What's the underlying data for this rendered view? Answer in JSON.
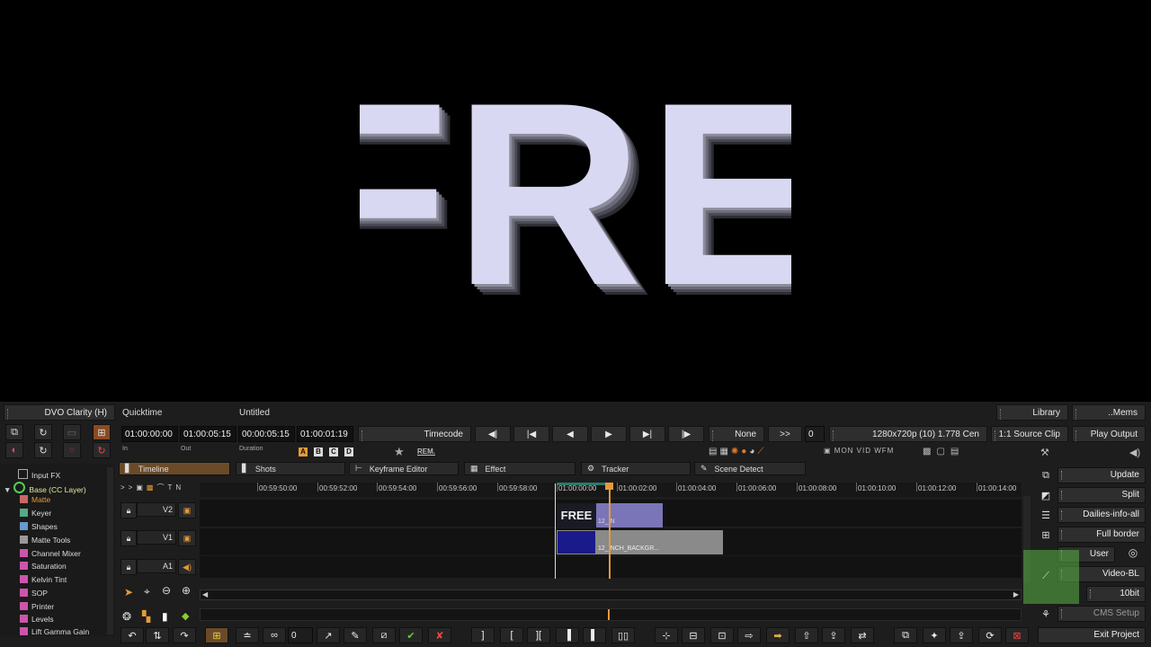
{
  "viewer": {
    "frame_text": "FREE"
  },
  "top": {
    "clarity_button": "DVO Clarity (H)",
    "format_label": "Quicktime",
    "title_label": "Untitled",
    "timecodes": [
      "01:00:00:00",
      "01:00:05:15",
      "00:00:05:15",
      "01:00:01:19"
    ],
    "timecode_captions": [
      "In",
      "Out",
      "Duration"
    ],
    "timecode_mode": "Timecode",
    "none_label": "None",
    "fwd_label": ">>",
    "count_value": "0",
    "resolution": "1280x720p (10) 1.778 Cen",
    "source_clip": "1:1 Source Clip",
    "play_output": "Play Output",
    "library": "Library",
    "mems": "..Mems",
    "abcd": [
      "A",
      "B",
      "C",
      "D"
    ],
    "rem_label": "REM."
  },
  "tabs": [
    "Timeline",
    "Shots",
    "Keyframe Editor",
    "Effect",
    "Tracker",
    "Scene Detect"
  ],
  "fx_tree": [
    "Input FX",
    "Base (CC Layer)",
    "Matte",
    "Keyer",
    "Shapes",
    "Matte Tools",
    "Channel Mixer",
    "Saturation",
    "Kelvin Tint",
    "SOP",
    "Printer",
    "Levels",
    "Lift Gamma Gain"
  ],
  "ruler": [
    "00:59:50:00",
    "00:59:52:00",
    "00:59:54:00",
    "00:59:56:00",
    "00:59:58:00",
    "01:00:00:00",
    "01:00:02:00",
    "01:00:04:00",
    "01:00:06:00",
    "01:00:08:00",
    "01:00:10:00",
    "01:00:12:00",
    "01:00:14:00"
  ],
  "tracks": [
    "V2",
    "V1",
    "A1"
  ],
  "clips": {
    "v2_thumb": "FREE",
    "v2_label": "12_IN",
    "v1_label": "12_INCH_BACKGR..."
  },
  "bottom": {
    "count_value": "0"
  },
  "right_panel": [
    "Update",
    "Split",
    "Dailies-info-all",
    "Full border",
    "User",
    "Video-BL",
    "10bit",
    "CMS Setup",
    "Exit Project"
  ],
  "colors": {
    "accent": "#e59a3a",
    "active_tab": "#6b4a2a",
    "clip_purple": "#7a75b8",
    "clip_gray": "#8a8a8a",
    "clip_blue": "#1a1a8a"
  }
}
